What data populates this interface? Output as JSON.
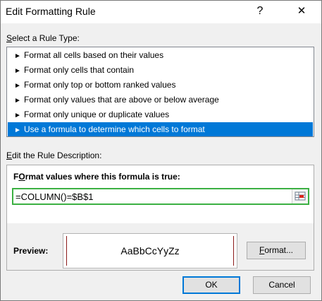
{
  "window": {
    "title": "Edit Formatting Rule",
    "help_glyph": "?",
    "close_glyph": "✕"
  },
  "rule_type": {
    "label_mnemonic": "S",
    "label_rest": "elect a Rule Type:",
    "bullet": "►",
    "items": [
      {
        "label": "Format all cells based on their values"
      },
      {
        "label": "Format only cells that contain"
      },
      {
        "label": "Format only top or bottom ranked values"
      },
      {
        "label": "Format only values that are above or below average"
      },
      {
        "label": "Format only unique or duplicate values"
      },
      {
        "label": "Use a formula to determine which cells to format"
      }
    ],
    "selected_index": 5
  },
  "description": {
    "label_mnemonic": "E",
    "label_rest": "dit the Rule Description:",
    "formula_label_mnemonic": "O",
    "formula_label_rest": "rmat values where this formula is true:",
    "formula_label_first": "F",
    "formula_value": "=COLUMN()=$B$1",
    "preview_label": "Preview:",
    "preview_sample": "AaBbCcYyZz",
    "format_button_mnemonic": "F",
    "format_button_rest": "ormat..."
  },
  "buttons": {
    "ok": "OK",
    "cancel": "Cancel"
  },
  "colors": {
    "selection": "#0078d7",
    "formula_border": "#3cb043",
    "preview_bar": "#8b1a1a"
  }
}
